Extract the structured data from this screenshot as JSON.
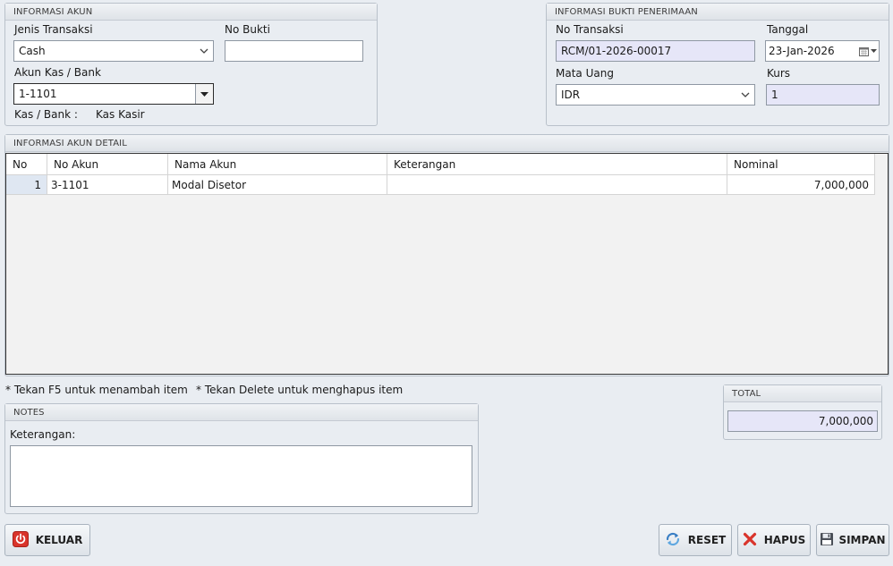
{
  "informasi_akun": {
    "header": "INFORMASI AKUN",
    "jenis_transaksi_label": "Jenis Transaksi",
    "jenis_transaksi_value": "Cash",
    "no_bukti_label": "No Bukti",
    "no_bukti_value": "",
    "akun_kas_label": "Akun Kas / Bank",
    "akun_kas_value": "1-1101",
    "kas_bank_label": "Kas / Bank :",
    "kas_bank_value": "Kas Kasir"
  },
  "informasi_bukti": {
    "header": "INFORMASI BUKTI PENERIMAAN",
    "no_transaksi_label": "No Transaksi",
    "no_transaksi_value": "RCM/01-2026-00017",
    "tanggal_label": "Tanggal",
    "tanggal_value": "23-Jan-2026",
    "mata_uang_label": "Mata Uang",
    "mata_uang_value": "IDR",
    "kurs_label": "Kurs",
    "kurs_value": "1"
  },
  "detail": {
    "header": "INFORMASI AKUN DETAIL",
    "columns": [
      "No",
      "No Akun",
      "Nama Akun",
      "Keterangan",
      "Nominal"
    ],
    "rows": [
      {
        "no": "1",
        "no_akun": "3-1101",
        "nama_akun": "Modal Disetor",
        "keterangan": "",
        "nominal": "7,000,000"
      }
    ]
  },
  "hints": {
    "add": "* Tekan F5 untuk menambah item",
    "delete": "* Tekan Delete untuk menghapus item"
  },
  "notes": {
    "header": "NOTES",
    "keterangan_label": "Keterangan:",
    "keterangan_value": ""
  },
  "total": {
    "header": "TOTAL",
    "value": "7,000,000"
  },
  "buttons": {
    "keluar": "KELUAR",
    "reset": "RESET",
    "hapus": "HAPUS",
    "simpan": "SIMPAN"
  },
  "colors": {
    "readonly_field": "#e6e6f8",
    "keluar_icon": "#d9342b",
    "hapus_icon": "#d9342b",
    "reset_icon": "#3a7fc4"
  }
}
